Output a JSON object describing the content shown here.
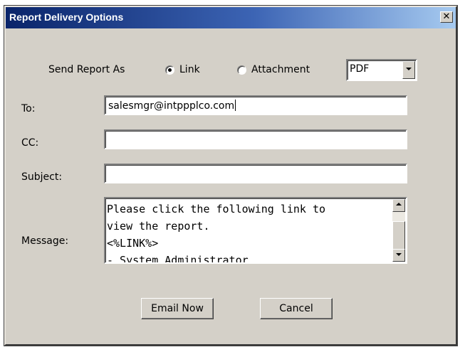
{
  "window": {
    "title": "Report Delivery Options",
    "close_glyph": "✕"
  },
  "send_as": {
    "label": "Send Report As",
    "options": [
      {
        "label": "Link",
        "selected": true
      },
      {
        "label": "Attachment",
        "selected": false
      }
    ],
    "format": "PDF"
  },
  "fields": {
    "to_label": "To:",
    "to_value": "salesmgr@intppplco.com",
    "cc_label": "CC:",
    "cc_value": "",
    "subject_label": "Subject:",
    "subject_value": "",
    "message_label": "Message:",
    "message_lines": [
      "Please click the following link to",
      "view the report.",
      "<%LINK%>",
      "- System Administrator"
    ]
  },
  "buttons": {
    "email_now": "Email Now",
    "cancel": "Cancel"
  }
}
